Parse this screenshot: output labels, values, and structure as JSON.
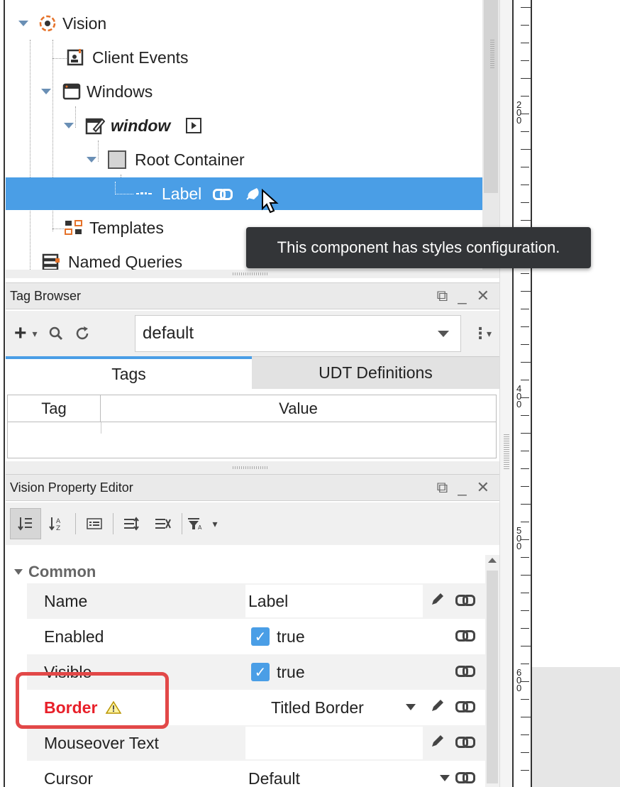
{
  "tree": {
    "items": [
      {
        "label": "Vision"
      },
      {
        "label": "Client Events"
      },
      {
        "label": "Windows"
      },
      {
        "label": "window"
      },
      {
        "label": "Root Container"
      },
      {
        "label": "Label"
      },
      {
        "label": "Templates"
      },
      {
        "label": "Named Queries"
      }
    ]
  },
  "tooltip": {
    "text": "This component has styles configuration."
  },
  "tag_browser": {
    "title": "Tag Browser",
    "provider": "default",
    "tabs": [
      {
        "label": "Tags"
      },
      {
        "label": "UDT Definitions"
      }
    ],
    "columns": [
      "Tag",
      "Value"
    ]
  },
  "property_editor": {
    "title": "Vision Property Editor",
    "section": "Common",
    "props": [
      {
        "name": "Name",
        "value": "Label"
      },
      {
        "name": "Enabled",
        "value": "true"
      },
      {
        "name": "Visible",
        "value": "true"
      },
      {
        "name": "Border",
        "value": "Titled Border"
      },
      {
        "name": "Mouseover Text",
        "value": ""
      },
      {
        "name": "Cursor",
        "value": "Default"
      }
    ]
  },
  "ruler": {
    "labels": [
      "200",
      "400",
      "500",
      "600"
    ]
  },
  "colors": {
    "selection": "#4a9ee6",
    "warning": "#e8202a",
    "highlight_box": "#e24848",
    "tooltip_bg": "#333538"
  }
}
